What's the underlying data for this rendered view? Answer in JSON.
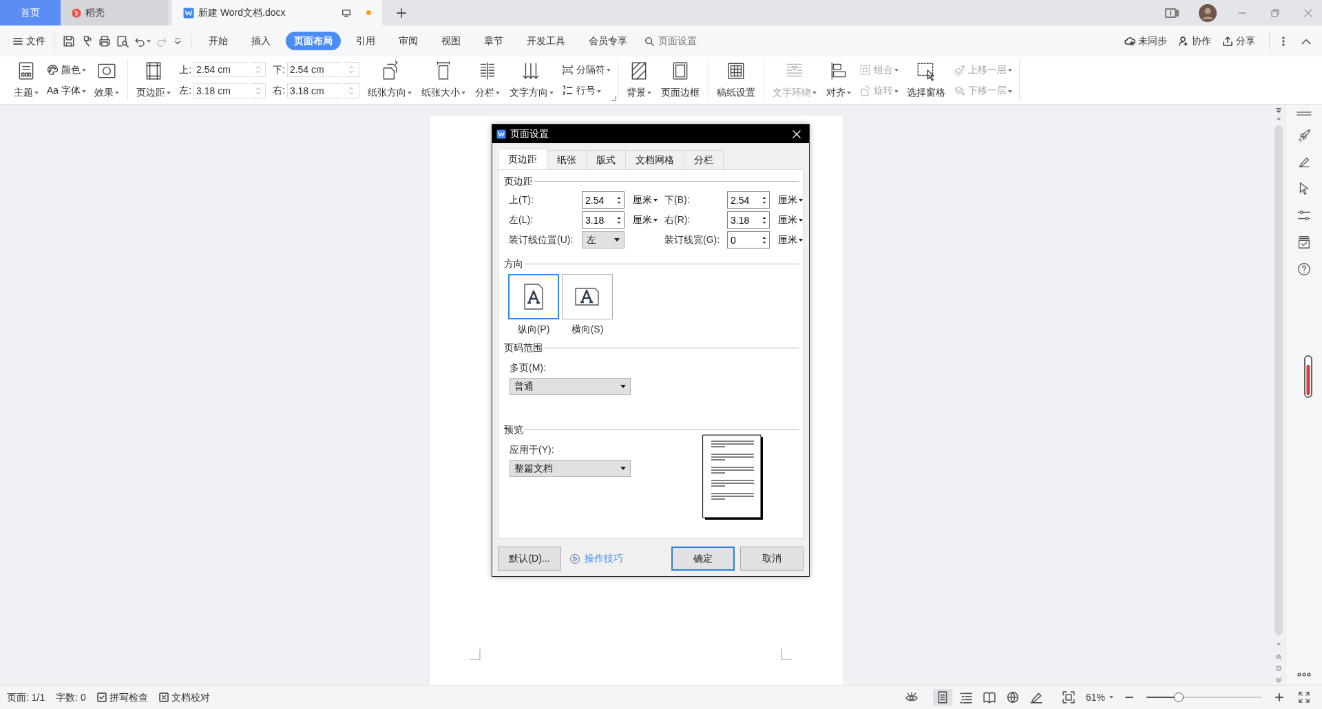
{
  "title_tabs": [
    {
      "label": "首页",
      "kind": "home",
      "selected": false
    },
    {
      "label": "稻壳",
      "kind": "app",
      "selected": false
    },
    {
      "label": "新建 Word文档.docx",
      "kind": "doc",
      "selected": true,
      "modified": true
    }
  ],
  "menu": {
    "file": "文件",
    "tabs": [
      {
        "label": "开始",
        "selected": false
      },
      {
        "label": "插入",
        "selected": false
      },
      {
        "label": "页面布局",
        "selected": true
      },
      {
        "label": "引用",
        "selected": false
      },
      {
        "label": "审阅",
        "selected": false
      },
      {
        "label": "视图",
        "selected": false
      },
      {
        "label": "章节",
        "selected": false
      },
      {
        "label": "开发工具",
        "selected": false
      },
      {
        "label": "会员专享",
        "selected": false
      }
    ],
    "search": {
      "placeholder": "页面设置"
    },
    "actions": [
      "未同步",
      "协作",
      "分享"
    ]
  },
  "ribbon_groups": [
    {
      "items": [
        {
          "kind": "big",
          "label": "主题",
          "dropdown": true,
          "disabled": false
        },
        {
          "kind": "stack",
          "items": [
            {
              "label": "颜色",
              "dropdown": true,
              "disabled": false
            },
            {
              "label": "字体",
              "glyph": "Aa",
              "dropdown": true,
              "disabled": false
            }
          ]
        },
        {
          "kind": "big",
          "label": "效果",
          "dropdown": true,
          "disabled": false
        }
      ]
    },
    {
      "launcher": true,
      "items": [
        {
          "kind": "big",
          "label": "页边距",
          "dropdown": true,
          "disabled": false
        },
        {
          "kind": "spins",
          "items": [
            {
              "label": "上:",
              "value": "2.54 cm"
            },
            {
              "label": "左:",
              "value": "3.18 cm"
            }
          ]
        },
        {
          "kind": "spins",
          "items": [
            {
              "label": "下:",
              "value": "2.54 cm"
            },
            {
              "label": "右:",
              "value": "3.18 cm"
            }
          ]
        },
        {
          "kind": "big",
          "label": "纸张方向",
          "dropdown": true,
          "disabled": false
        },
        {
          "kind": "big",
          "label": "纸张大小",
          "dropdown": true,
          "disabled": false
        },
        {
          "kind": "big",
          "label": "分栏",
          "dropdown": true,
          "disabled": false
        },
        {
          "kind": "big",
          "label": "文字方向",
          "dropdown": true,
          "disabled": false
        },
        {
          "kind": "stack",
          "items": [
            {
              "label": "分隔符",
              "dropdown": true,
              "disabled": false
            },
            {
              "label": "行号",
              "dropdown": true,
              "disabled": false
            }
          ]
        }
      ]
    },
    {
      "items": [
        {
          "kind": "big",
          "label": "背景",
          "dropdown": true,
          "disabled": false
        },
        {
          "kind": "big",
          "label": "页面边框",
          "dropdown": false,
          "disabled": false
        }
      ]
    },
    {
      "items": [
        {
          "kind": "big",
          "label": "稿纸设置",
          "dropdown": false,
          "disabled": false
        }
      ]
    },
    {
      "items": [
        {
          "kind": "big",
          "label": "文字环绕",
          "dropdown": true,
          "disabled": true
        },
        {
          "kind": "big",
          "label": "对齐",
          "dropdown": true,
          "disabled": false
        },
        {
          "kind": "stack",
          "items": [
            {
              "label": "组合",
              "dropdown": true,
              "disabled": true
            },
            {
              "label": "旋转",
              "dropdown": true,
              "disabled": true
            }
          ]
        },
        {
          "kind": "big",
          "label": "选择窗格",
          "dropdown": false,
          "disabled": false
        },
        {
          "kind": "stack",
          "items": [
            {
              "label": "上移一层",
              "dropdown": true,
              "disabled": true
            },
            {
              "label": "下移一层",
              "dropdown": true,
              "disabled": true
            }
          ]
        }
      ]
    }
  ],
  "dialog": {
    "title": "页面设置",
    "tabs": [
      {
        "label": "页边距",
        "selected": true
      },
      {
        "label": "纸张",
        "selected": false
      },
      {
        "label": "版式",
        "selected": false
      },
      {
        "label": "文档网格",
        "selected": false
      },
      {
        "label": "分栏",
        "selected": false
      }
    ],
    "margins": {
      "heading": "页边距",
      "rows": [
        [
          {
            "kind": "spin",
            "label": "上(T):",
            "value": "2.54",
            "unit": "厘米"
          },
          {
            "kind": "spin",
            "label": "下(B):",
            "value": "2.54",
            "unit": "厘米"
          }
        ],
        [
          {
            "kind": "spin",
            "label": "左(L):",
            "value": "3.18",
            "unit": "厘米"
          },
          {
            "kind": "spin",
            "label": "右(R):",
            "value": "3.18",
            "unit": "厘米"
          }
        ],
        [
          {
            "kind": "select",
            "label": "装订线位置(U):",
            "value": "左"
          },
          {
            "kind": "spin",
            "label": "装订线宽(G):",
            "value": "0",
            "unit": "厘米"
          }
        ]
      ]
    },
    "orientation": {
      "heading": "方向",
      "options": [
        {
          "kind": "portrait",
          "label": "纵向(P)",
          "selected": true
        },
        {
          "kind": "landscape",
          "label": "横向(S)",
          "selected": false
        }
      ]
    },
    "pages": {
      "heading": "页码范围",
      "label": "多页(M):",
      "value": "普通"
    },
    "preview": {
      "heading": "预览",
      "label": "应用于(Y):",
      "value": "整篇文档"
    },
    "buttons": [
      {
        "kind": "button",
        "label": "默认(D)...",
        "default": false
      },
      {
        "kind": "link",
        "label": "操作技巧",
        "default": false
      },
      {
        "kind": "button",
        "label": "确定",
        "default": true
      },
      {
        "kind": "button",
        "label": "取消",
        "default": false
      }
    ]
  },
  "status_bar": {
    "left": [
      {
        "kind": "text",
        "label": "页面: 1/1"
      },
      {
        "kind": "text",
        "label": "字数: 0"
      },
      {
        "kind": "check",
        "label": "拼写检查"
      },
      {
        "kind": "cross",
        "label": "文档校对"
      }
    ],
    "views": [
      {
        "selected": false
      },
      {
        "selected": true
      },
      {
        "selected": false
      },
      {
        "selected": false
      },
      {
        "selected": false
      },
      {
        "selected": false
      }
    ],
    "zoom": {
      "value": "61%",
      "level": 0.28
    }
  }
}
